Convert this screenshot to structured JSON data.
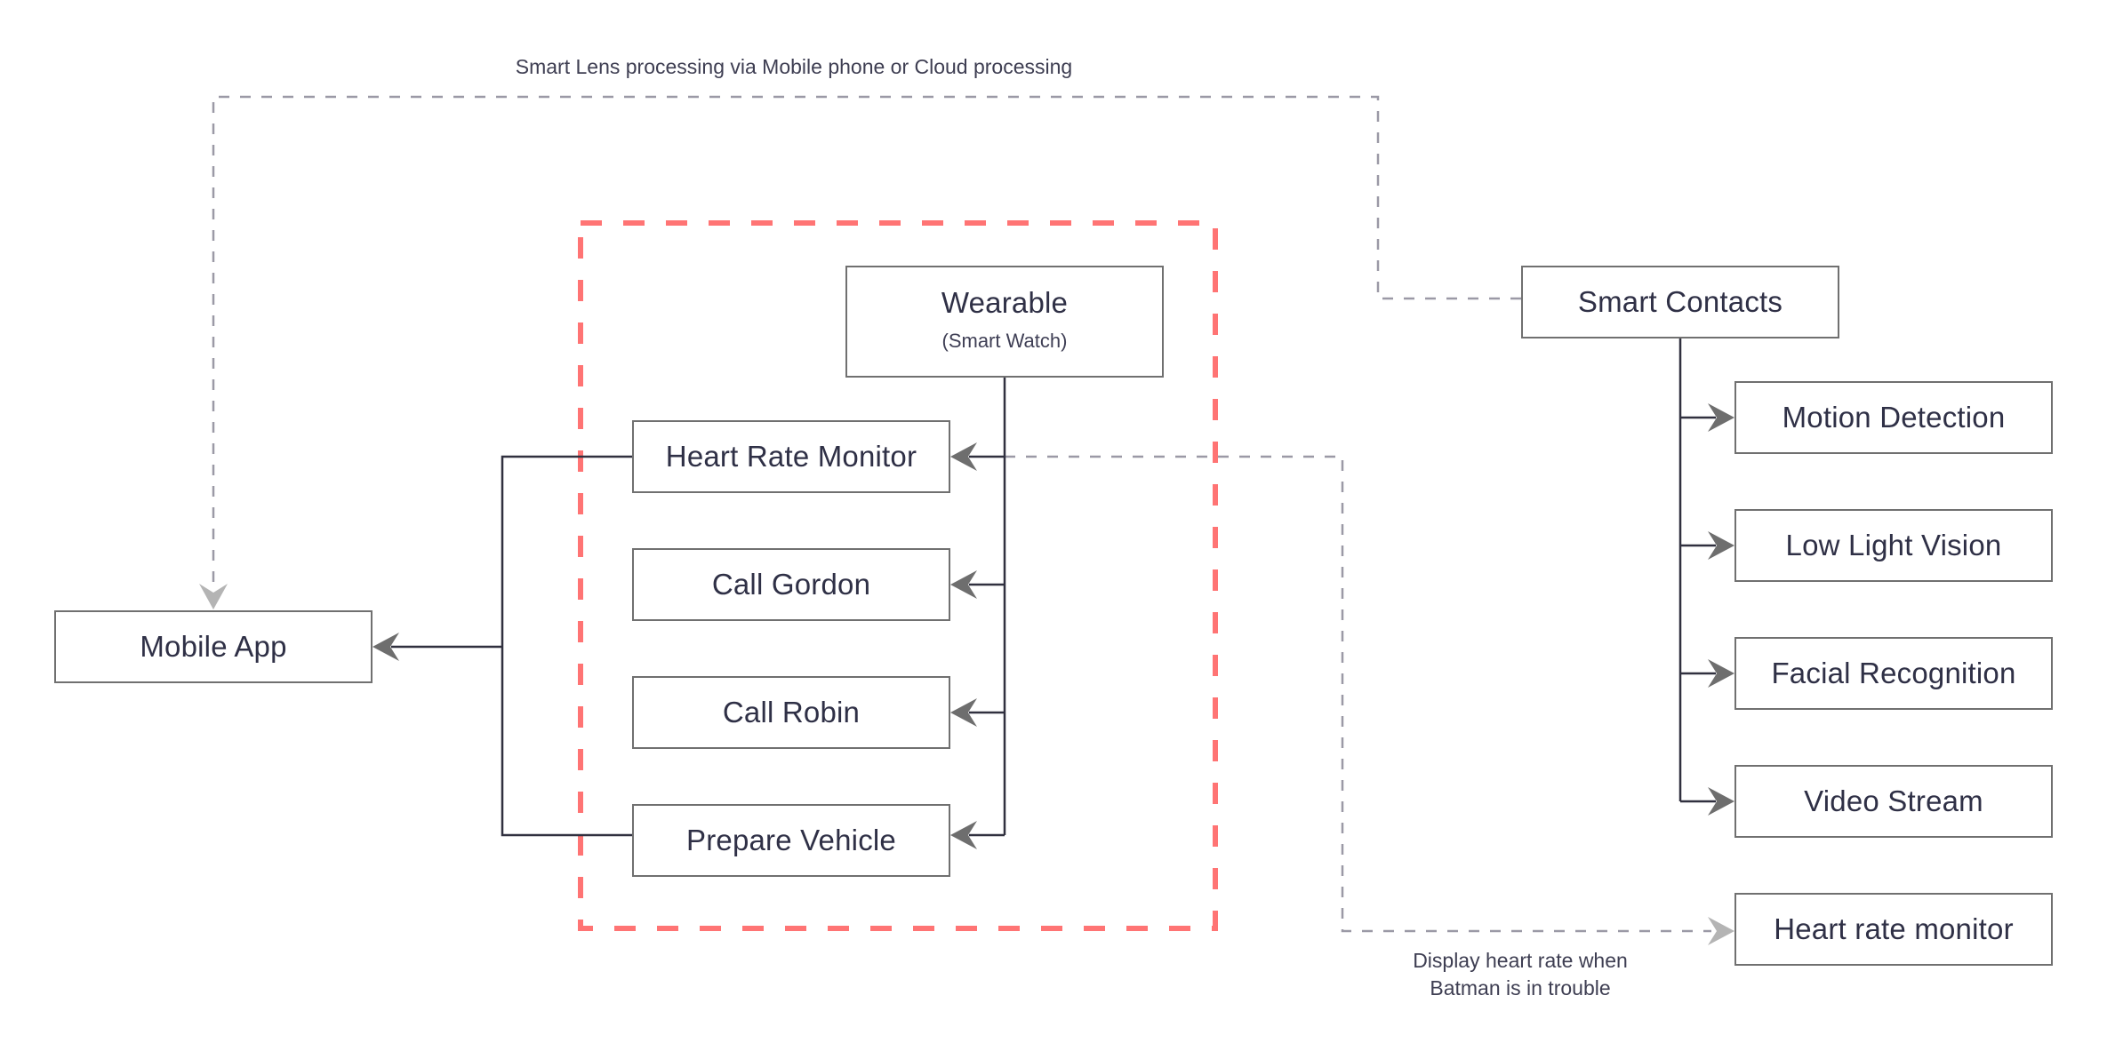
{
  "diagram": {
    "annotations": {
      "smart_lens": "Smart Lens processing via Mobile phone or Cloud processing",
      "heart_rate_line1": "Display heart rate when",
      "heart_rate_line2": "Batman is in trouble"
    },
    "nodes": {
      "mobile_app": {
        "label": "Mobile App"
      },
      "wearable": {
        "label": "Wearable",
        "sublabel": "(Smart Watch)"
      },
      "heart_rate_monitor": {
        "label": "Heart Rate Monitor"
      },
      "call_gordon": {
        "label": "Call Gordon"
      },
      "call_robin": {
        "label": "Call Robin"
      },
      "prepare_vehicle": {
        "label": "Prepare Vehicle"
      },
      "smart_contacts": {
        "label": "Smart Contacts"
      },
      "motion_detection": {
        "label": "Motion Detection"
      },
      "low_light_vision": {
        "label": "Low Light Vision"
      },
      "facial_recognition": {
        "label": "Facial Recognition"
      },
      "video_stream": {
        "label": "Video Stream"
      },
      "heart_rate_monitor_display": {
        "label": "Heart rate monitor"
      }
    },
    "edges": [
      {
        "from": "wearable",
        "to": "heart_rate_monitor",
        "style": "solid"
      },
      {
        "from": "wearable",
        "to": "call_gordon",
        "style": "solid"
      },
      {
        "from": "wearable",
        "to": "call_robin",
        "style": "solid"
      },
      {
        "from": "wearable",
        "to": "prepare_vehicle",
        "style": "solid"
      },
      {
        "from": "heart_rate_monitor",
        "to": "mobile_app",
        "style": "solid"
      },
      {
        "from": "prepare_vehicle",
        "to": "mobile_app",
        "style": "solid"
      },
      {
        "from": "smart_contacts",
        "to": "motion_detection",
        "style": "solid"
      },
      {
        "from": "smart_contacts",
        "to": "low_light_vision",
        "style": "solid"
      },
      {
        "from": "smart_contacts",
        "to": "facial_recognition",
        "style": "solid"
      },
      {
        "from": "smart_contacts",
        "to": "video_stream",
        "style": "solid"
      },
      {
        "from": "smart_contacts",
        "to": "mobile_app",
        "style": "dashed",
        "label": "Smart Lens processing via Mobile phone or Cloud processing"
      },
      {
        "from": "heart_rate_monitor",
        "to": "heart_rate_monitor_display",
        "style": "dashed",
        "label": "Display heart rate when Batman is in trouble"
      }
    ],
    "groups": [
      {
        "name": "wearable-group",
        "style": "dashed",
        "members": [
          "wearable",
          "heart_rate_monitor",
          "call_gordon",
          "call_robin",
          "prepare_vehicle"
        ]
      }
    ],
    "colors": {
      "group_border": "#ff7474",
      "solid_line": "#30303f",
      "dashed_line": "#9b99a6",
      "arrow_dark": "#6e6e6e",
      "arrow_light": "#b4b4b4",
      "node_border": "#707070",
      "text": "#2f3046"
    }
  }
}
